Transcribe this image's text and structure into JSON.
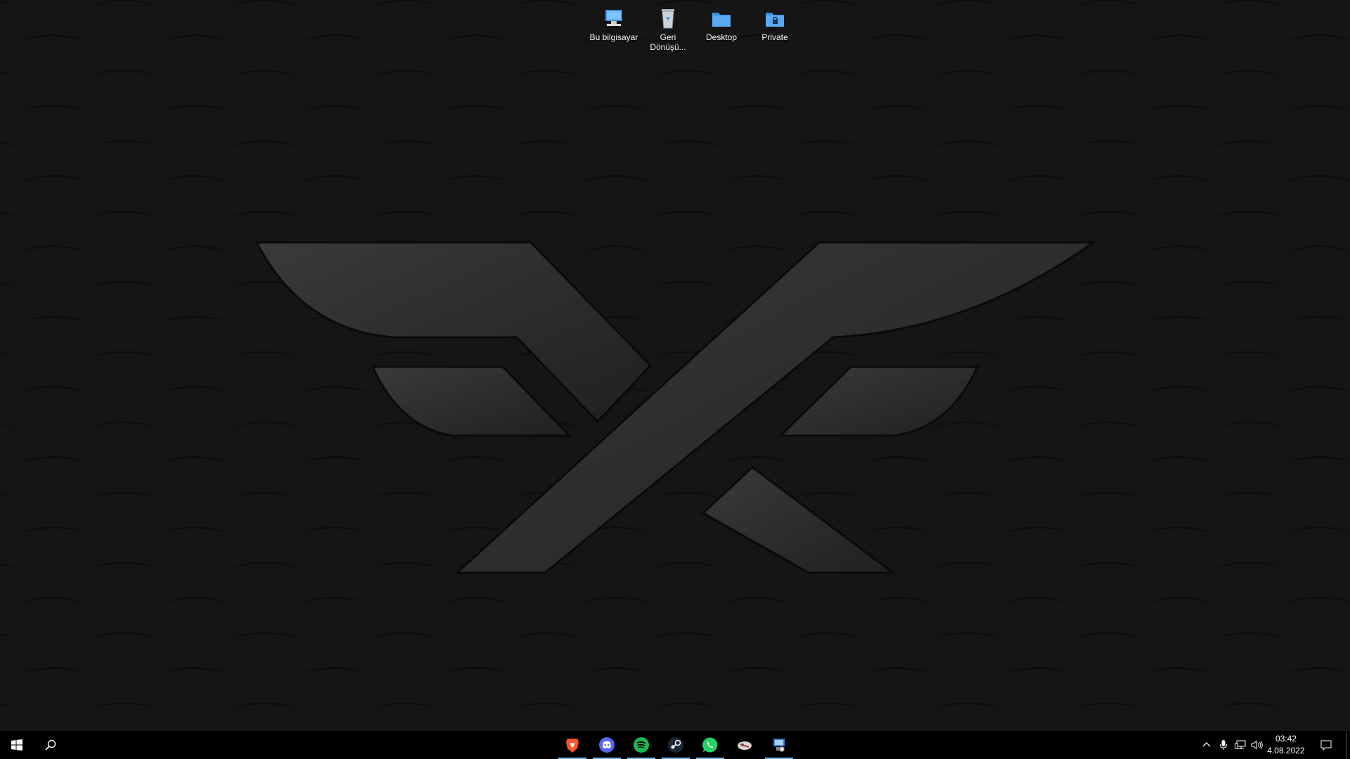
{
  "desktop": {
    "icons": [
      {
        "label": "Bu bilgisayar",
        "icon": "computer-icon"
      },
      {
        "label": "Geri\nDönüşü...",
        "icon": "recycle-bin-icon"
      },
      {
        "label": "Desktop",
        "icon": "folder-icon"
      },
      {
        "label": "Private",
        "icon": "locked-folder-icon"
      }
    ]
  },
  "taskbar": {
    "start_icon": "windows-start-icon",
    "search_icon": "search-icon",
    "apps": [
      {
        "icon": "brave-browser-icon",
        "color": "#fb542b"
      },
      {
        "icon": "discord-icon",
        "color": "#5865f2"
      },
      {
        "icon": "spotify-icon",
        "color": "#1db954"
      },
      {
        "icon": "steam-icon",
        "color": "#1b2838"
      },
      {
        "icon": "whatsapp-icon",
        "color": "#25d366"
      },
      {
        "icon": "app-icon",
        "color": "#d9d9d9"
      },
      {
        "icon": "network-app-icon",
        "color": "#3a7bd5"
      }
    ],
    "running_indicator_color": "#76b9ed",
    "tray": {
      "icons": [
        "chevron-up-icon",
        "microphone-icon",
        "network-icon",
        "volume-icon"
      ],
      "time": "03:42",
      "date": "4.08.2022",
      "notification_icon": "notification-icon"
    }
  }
}
